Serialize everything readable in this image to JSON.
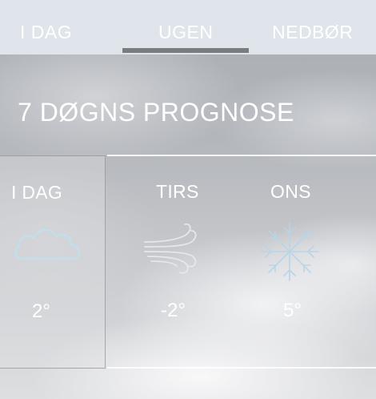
{
  "tabs": [
    {
      "label": "I DAG",
      "active": false
    },
    {
      "label": "UGEN",
      "active": true
    },
    {
      "label": "NEDBØR",
      "active": false
    }
  ],
  "heading": "7 DØGNS PROGNOSE",
  "days": [
    {
      "name": "I DAG",
      "icon": "cloud-icon",
      "temp": "2°",
      "selected": true
    },
    {
      "name": "TIRS",
      "icon": "wind-icon",
      "temp": "-2°",
      "selected": false
    },
    {
      "name": "ONS",
      "icon": "snowflake-icon",
      "temp": "5°",
      "selected": false
    }
  ],
  "colors": {
    "tabbar_bg": "#dfe5ea",
    "tab_indicator": "#7a7d80",
    "text": "#ffffff",
    "cloud_icon": "#bfe0ee",
    "wind_icon": "#e6e7e9",
    "snow_icon": "#b9d4e8"
  }
}
